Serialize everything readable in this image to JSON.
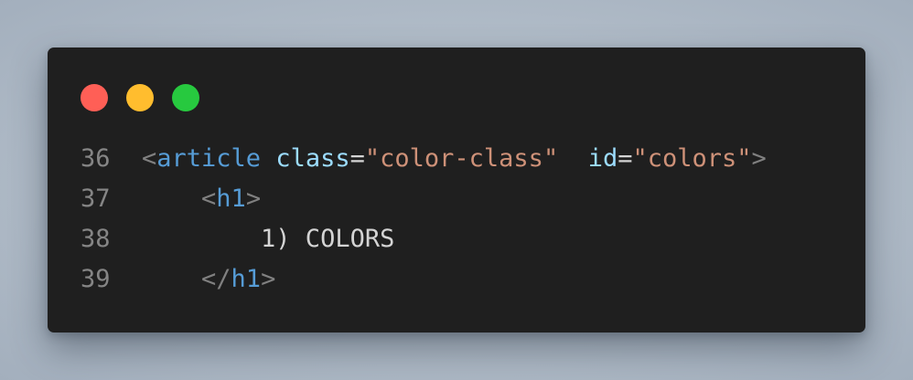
{
  "window": {
    "buttons": [
      {
        "name": "close",
        "color": "#ff5f56"
      },
      {
        "name": "minimize",
        "color": "#ffbd2e"
      },
      {
        "name": "maximize",
        "color": "#27c93f"
      }
    ]
  },
  "colors": {
    "background": "#1f1f1f",
    "line_number": "#858585",
    "punctuation": "#808080",
    "tag": "#569cd6",
    "attribute": "#9cdcfe",
    "string": "#ce9178",
    "text": "#d4d4d4"
  },
  "code": {
    "lines": [
      {
        "number": "36",
        "tokens": [
          {
            "type": "punct",
            "text": "<"
          },
          {
            "type": "tag",
            "text": "article"
          },
          {
            "type": "txt",
            "text": " "
          },
          {
            "type": "attr",
            "text": "class"
          },
          {
            "type": "eq",
            "text": "="
          },
          {
            "type": "str",
            "text": "\"color-class\""
          },
          {
            "type": "txt",
            "text": "  "
          },
          {
            "type": "attr",
            "text": "id"
          },
          {
            "type": "eq",
            "text": "="
          },
          {
            "type": "str",
            "text": "\"colors\""
          },
          {
            "type": "punct",
            "text": ">"
          }
        ]
      },
      {
        "number": "37",
        "tokens": [
          {
            "type": "txt",
            "text": "    "
          },
          {
            "type": "punct",
            "text": "<"
          },
          {
            "type": "tag",
            "text": "h1"
          },
          {
            "type": "punct",
            "text": ">"
          }
        ]
      },
      {
        "number": "38",
        "tokens": [
          {
            "type": "txt",
            "text": "        1) COLORS"
          }
        ]
      },
      {
        "number": "39",
        "tokens": [
          {
            "type": "txt",
            "text": "    "
          },
          {
            "type": "punct",
            "text": "</"
          },
          {
            "type": "tag",
            "text": "h1"
          },
          {
            "type": "punct",
            "text": ">"
          }
        ]
      }
    ]
  }
}
